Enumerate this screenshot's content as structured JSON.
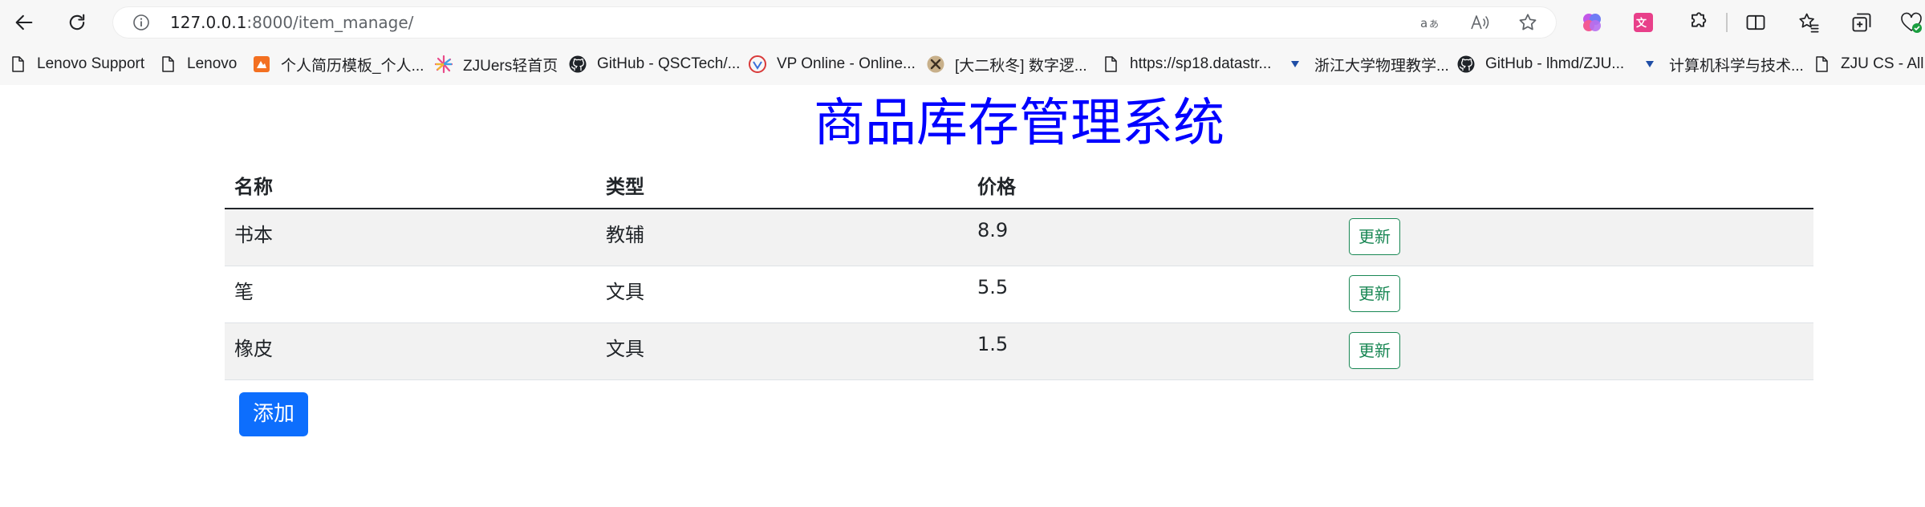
{
  "browser": {
    "url_host": "127.0.0.1",
    "url_rest": ":8000/item_manage/"
  },
  "bookmarks": [
    {
      "label": "Lenovo Support",
      "icon": "page-icon"
    },
    {
      "label": "Lenovo",
      "icon": "page-icon"
    },
    {
      "label": "个人简历模板_个人...",
      "icon": "resume-site-icon"
    },
    {
      "label": "ZJUers轻首页",
      "icon": "pinwheel-icon"
    },
    {
      "label": "GitHub - QSCTech/...",
      "icon": "github-icon"
    },
    {
      "label": "VP Online - Online...",
      "icon": "vp-online-icon"
    },
    {
      "label": "[大二秋冬] 数字逻...",
      "icon": "cross-icon"
    },
    {
      "label": "https://sp18.datastr...",
      "icon": "page-icon"
    },
    {
      "label": "浙江大学物理教学...",
      "icon": "triangle-icon"
    },
    {
      "label": "GitHub - lhmd/ZJU...",
      "icon": "github-icon"
    },
    {
      "label": "计算机科学与技术...",
      "icon": "triangle-icon"
    },
    {
      "label": "ZJU CS - All S",
      "icon": "page-icon"
    }
  ],
  "page": {
    "title": "商品库存管理系统",
    "table": {
      "headers": [
        "名称",
        "类型",
        "价格"
      ],
      "rows": [
        {
          "name": "书本",
          "type": "教辅",
          "price": "8.9",
          "action": "更新"
        },
        {
          "name": "笔",
          "type": "文具",
          "price": "5.5",
          "action": "更新"
        },
        {
          "name": "橡皮",
          "type": "文具",
          "price": "1.5",
          "action": "更新"
        }
      ]
    },
    "add_label": "添加"
  },
  "colors": {
    "title": "#0000ff",
    "update_button": "#198754",
    "add_button": "#0d6efd",
    "striped_row": "#f2f2f2"
  }
}
